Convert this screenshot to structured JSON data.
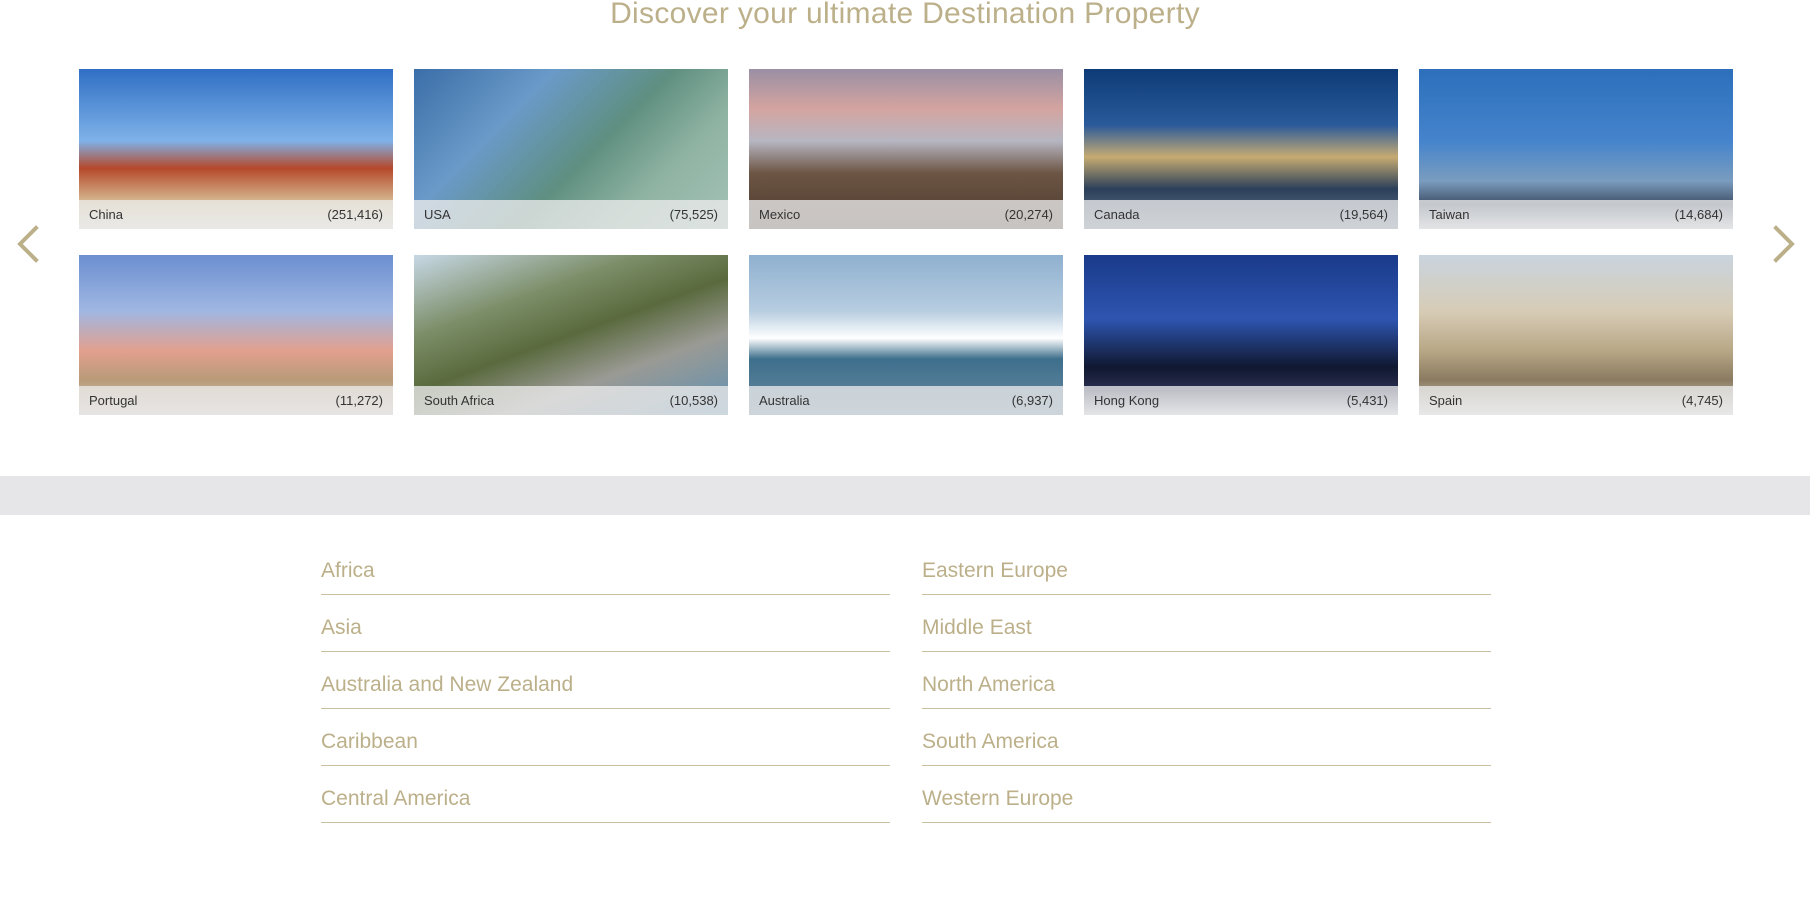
{
  "page": {
    "title": "Discover your ultimate Destination Property"
  },
  "carousel": {
    "prev_icon": "chevron-left-icon",
    "next_icon": "chevron-right-icon",
    "accent_color": "#bcb08a",
    "tiles": [
      {
        "name": "China",
        "count": "(251,416)"
      },
      {
        "name": "USA",
        "count": "(75,525)"
      },
      {
        "name": "Mexico",
        "count": "(20,274)"
      },
      {
        "name": "Canada",
        "count": "(19,564)"
      },
      {
        "name": "Taiwan",
        "count": "(14,684)"
      },
      {
        "name": "Portugal",
        "count": "(11,272)"
      },
      {
        "name": "South Africa",
        "count": "(10,538)"
      },
      {
        "name": "Australia",
        "count": "(6,937)"
      },
      {
        "name": "Hong Kong",
        "count": "(5,431)"
      },
      {
        "name": "Spain",
        "count": "(4,745)"
      }
    ]
  },
  "regions": {
    "left": [
      "Africa",
      "Asia",
      "Australia and New Zealand",
      "Caribbean",
      "Central America"
    ],
    "right": [
      "Eastern Europe",
      "Middle East",
      "North America",
      "South America",
      "Western Europe"
    ]
  }
}
